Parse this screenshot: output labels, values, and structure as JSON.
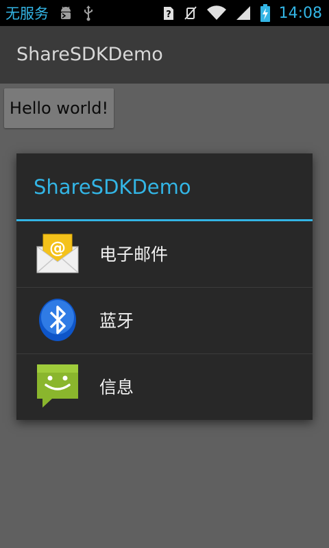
{
  "status_bar": {
    "carrier": "无服务",
    "time": "14:08",
    "icons": [
      "android-debug-icon",
      "usb-icon",
      "no-sim-icon",
      "vibrate-off-icon",
      "wifi-icon",
      "signal-icon",
      "battery-charging-icon"
    ]
  },
  "action_bar": {
    "title": "ShareSDKDemo"
  },
  "content": {
    "hello_button": "Hello world!"
  },
  "dialog": {
    "title": "ShareSDKDemo",
    "accent_color": "#33b5e5",
    "items": [
      {
        "label": "电子邮件",
        "icon": "email-icon"
      },
      {
        "label": "蓝牙",
        "icon": "bluetooth-icon"
      },
      {
        "label": "信息",
        "icon": "messaging-icon"
      }
    ]
  }
}
